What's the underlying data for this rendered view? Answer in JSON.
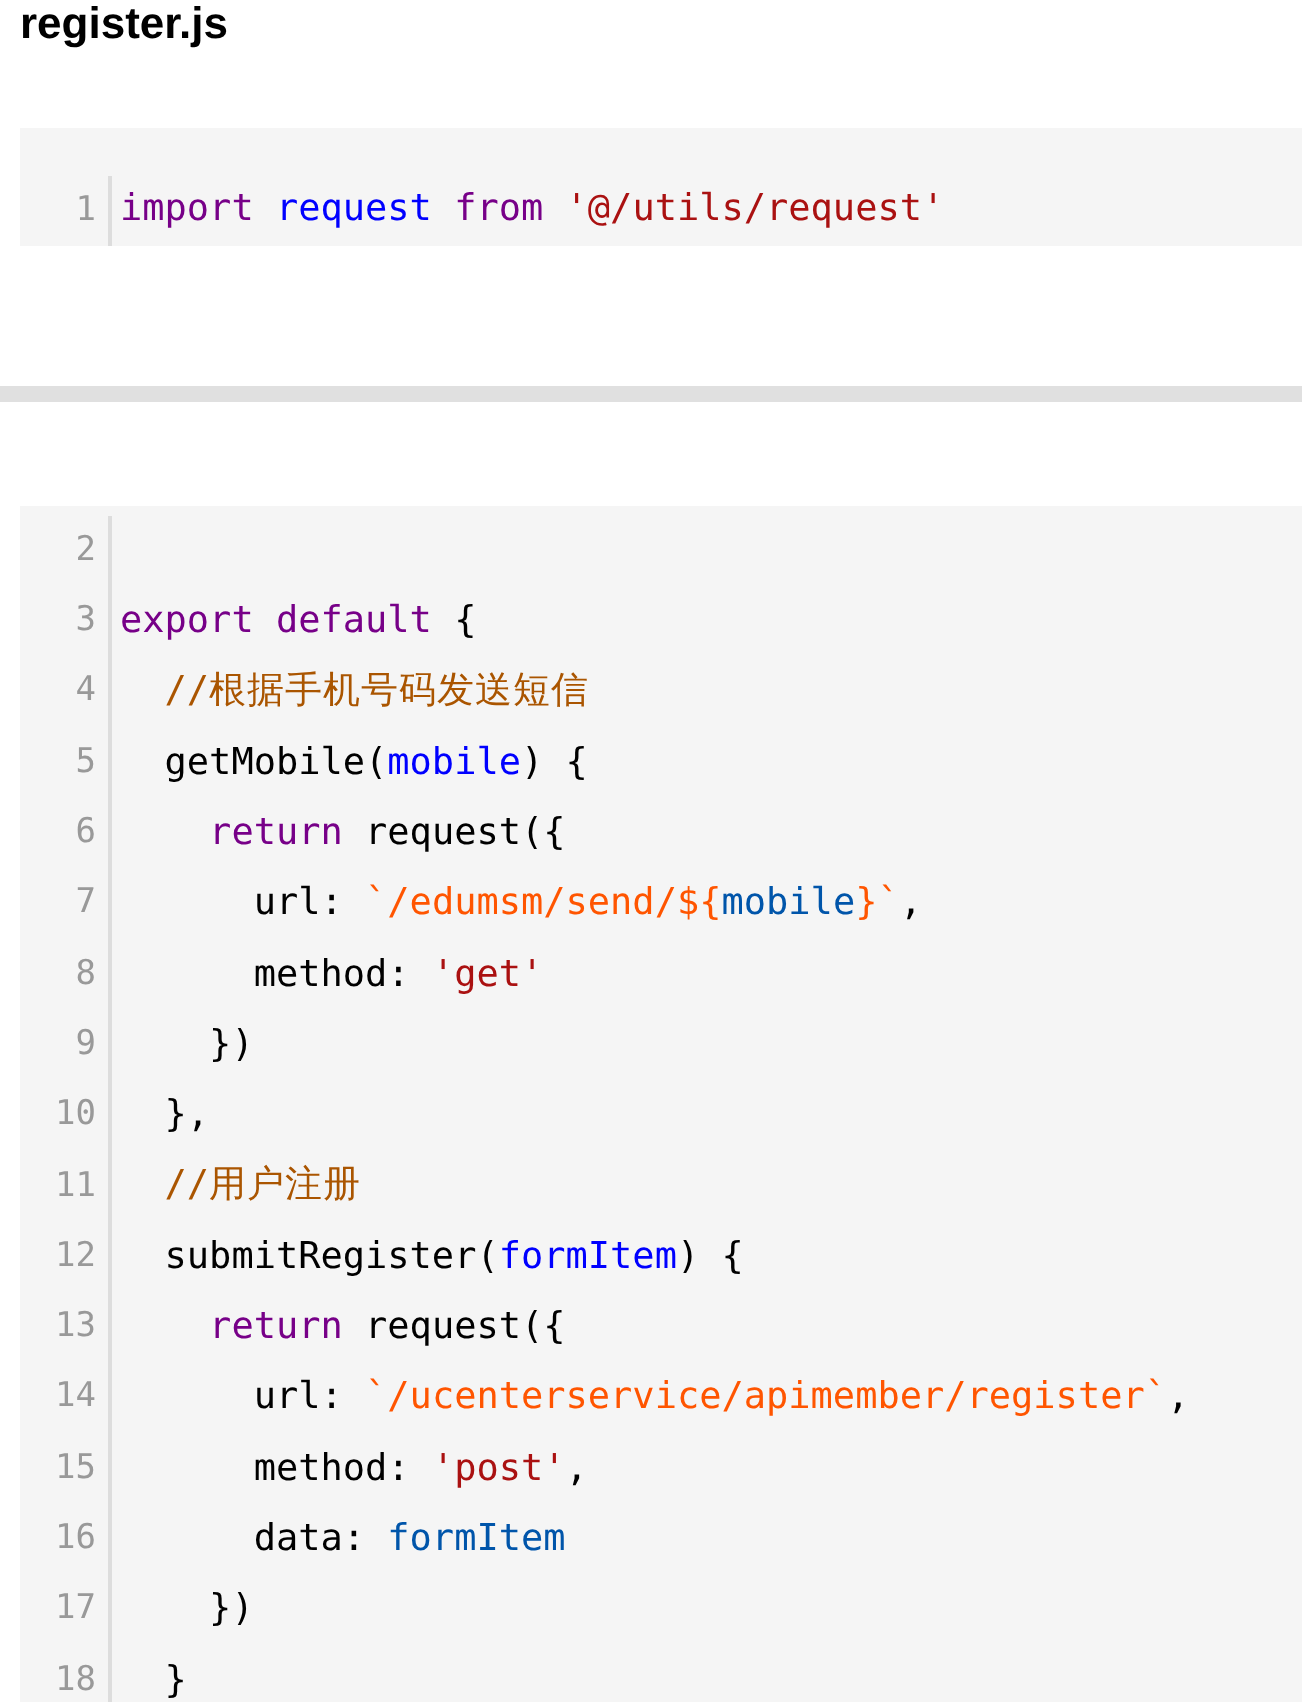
{
  "title": "register.js",
  "blocks": [
    {
      "lines": [
        {
          "number": "1",
          "tokens": [
            {
              "kind": "keyword",
              "text": "import"
            },
            {
              "kind": "def",
              "text": " request"
            },
            {
              "kind": "keyword",
              "text": " from"
            },
            {
              "kind": "string",
              "text": " '@/utils/request'"
            }
          ]
        }
      ]
    },
    {
      "lines": [
        {
          "number": "2"
        },
        {
          "number": "3",
          "tokens": [
            {
              "kind": "keyword",
              "text": "export"
            },
            {
              "kind": "keyword",
              "text": " default"
            },
            {
              "kind": "plain",
              "text": " {"
            }
          ]
        },
        {
          "number": "4",
          "tokens": [
            {
              "kind": "comment",
              "text": "  //根据手机号码发送短信"
            }
          ]
        },
        {
          "number": "5",
          "tokens": [
            {
              "kind": "plain",
              "text": "  getMobile("
            },
            {
              "kind": "def",
              "text": "mobile"
            },
            {
              "kind": "plain",
              "text": ") {"
            }
          ]
        },
        {
          "number": "6",
          "tokens": [
            {
              "kind": "keyword",
              "text": "    return"
            },
            {
              "kind": "plain",
              "text": " request({"
            }
          ]
        },
        {
          "number": "7",
          "tokens": [
            {
              "kind": "plain",
              "text": "      url: "
            },
            {
              "kind": "template",
              "text": "`/edumsm/send/${"
            },
            {
              "kind": "variable",
              "text": "mobile"
            },
            {
              "kind": "template",
              "text": "}`"
            },
            {
              "kind": "plain",
              "text": ","
            }
          ]
        },
        {
          "number": "8",
          "tokens": [
            {
              "kind": "plain",
              "text": "      method: "
            },
            {
              "kind": "string",
              "text": "'get'"
            }
          ]
        },
        {
          "number": "9",
          "tokens": [
            {
              "kind": "plain",
              "text": "    })"
            }
          ]
        },
        {
          "number": "10",
          "tokens": [
            {
              "kind": "plain",
              "text": "  },"
            }
          ]
        },
        {
          "number": "11",
          "tokens": [
            {
              "kind": "comment",
              "text": "  //用户注册"
            }
          ]
        },
        {
          "number": "12",
          "tokens": [
            {
              "kind": "plain",
              "text": "  submitRegister("
            },
            {
              "kind": "def",
              "text": "formItem"
            },
            {
              "kind": "plain",
              "text": ") {"
            }
          ]
        },
        {
          "number": "13",
          "tokens": [
            {
              "kind": "keyword",
              "text": "    return"
            },
            {
              "kind": "plain",
              "text": " request({"
            }
          ]
        },
        {
          "number": "14",
          "tokens": [
            {
              "kind": "plain",
              "text": "      url: "
            },
            {
              "kind": "template",
              "text": "`/ucenterservice/apimember/register`"
            },
            {
              "kind": "plain",
              "text": ","
            }
          ]
        },
        {
          "number": "15",
          "tokens": [
            {
              "kind": "plain",
              "text": "      method: "
            },
            {
              "kind": "string",
              "text": "'post'"
            },
            {
              "kind": "plain",
              "text": ","
            }
          ]
        },
        {
          "number": "16",
          "tokens": [
            {
              "kind": "plain",
              "text": "      data: "
            },
            {
              "kind": "variable",
              "text": "formItem"
            }
          ]
        },
        {
          "number": "17",
          "tokens": [
            {
              "kind": "plain",
              "text": "    })"
            }
          ]
        },
        {
          "number": "18",
          "tokens": [
            {
              "kind": "plain",
              "text": "  }"
            }
          ]
        }
      ]
    }
  ]
}
